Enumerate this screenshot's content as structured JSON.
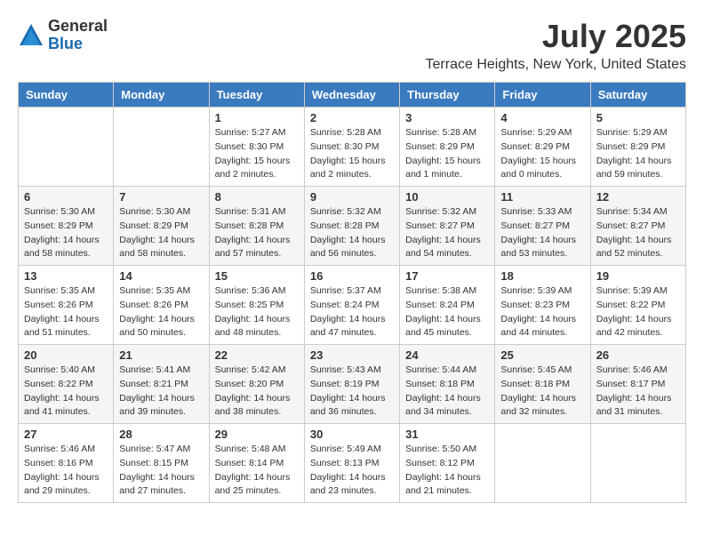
{
  "header": {
    "logo_general": "General",
    "logo_blue": "Blue",
    "month_year": "July 2025",
    "location": "Terrace Heights, New York, United States"
  },
  "weekdays": [
    "Sunday",
    "Monday",
    "Tuesday",
    "Wednesday",
    "Thursday",
    "Friday",
    "Saturday"
  ],
  "weeks": [
    [
      {
        "day": "",
        "info": ""
      },
      {
        "day": "",
        "info": ""
      },
      {
        "day": "1",
        "info": "Sunrise: 5:27 AM\nSunset: 8:30 PM\nDaylight: 15 hours\nand 2 minutes."
      },
      {
        "day": "2",
        "info": "Sunrise: 5:28 AM\nSunset: 8:30 PM\nDaylight: 15 hours\nand 2 minutes."
      },
      {
        "day": "3",
        "info": "Sunrise: 5:28 AM\nSunset: 8:29 PM\nDaylight: 15 hours\nand 1 minute."
      },
      {
        "day": "4",
        "info": "Sunrise: 5:29 AM\nSunset: 8:29 PM\nDaylight: 15 hours\nand 0 minutes."
      },
      {
        "day": "5",
        "info": "Sunrise: 5:29 AM\nSunset: 8:29 PM\nDaylight: 14 hours\nand 59 minutes."
      }
    ],
    [
      {
        "day": "6",
        "info": "Sunrise: 5:30 AM\nSunset: 8:29 PM\nDaylight: 14 hours\nand 58 minutes."
      },
      {
        "day": "7",
        "info": "Sunrise: 5:30 AM\nSunset: 8:29 PM\nDaylight: 14 hours\nand 58 minutes."
      },
      {
        "day": "8",
        "info": "Sunrise: 5:31 AM\nSunset: 8:28 PM\nDaylight: 14 hours\nand 57 minutes."
      },
      {
        "day": "9",
        "info": "Sunrise: 5:32 AM\nSunset: 8:28 PM\nDaylight: 14 hours\nand 56 minutes."
      },
      {
        "day": "10",
        "info": "Sunrise: 5:32 AM\nSunset: 8:27 PM\nDaylight: 14 hours\nand 54 minutes."
      },
      {
        "day": "11",
        "info": "Sunrise: 5:33 AM\nSunset: 8:27 PM\nDaylight: 14 hours\nand 53 minutes."
      },
      {
        "day": "12",
        "info": "Sunrise: 5:34 AM\nSunset: 8:27 PM\nDaylight: 14 hours\nand 52 minutes."
      }
    ],
    [
      {
        "day": "13",
        "info": "Sunrise: 5:35 AM\nSunset: 8:26 PM\nDaylight: 14 hours\nand 51 minutes."
      },
      {
        "day": "14",
        "info": "Sunrise: 5:35 AM\nSunset: 8:26 PM\nDaylight: 14 hours\nand 50 minutes."
      },
      {
        "day": "15",
        "info": "Sunrise: 5:36 AM\nSunset: 8:25 PM\nDaylight: 14 hours\nand 48 minutes."
      },
      {
        "day": "16",
        "info": "Sunrise: 5:37 AM\nSunset: 8:24 PM\nDaylight: 14 hours\nand 47 minutes."
      },
      {
        "day": "17",
        "info": "Sunrise: 5:38 AM\nSunset: 8:24 PM\nDaylight: 14 hours\nand 45 minutes."
      },
      {
        "day": "18",
        "info": "Sunrise: 5:39 AM\nSunset: 8:23 PM\nDaylight: 14 hours\nand 44 minutes."
      },
      {
        "day": "19",
        "info": "Sunrise: 5:39 AM\nSunset: 8:22 PM\nDaylight: 14 hours\nand 42 minutes."
      }
    ],
    [
      {
        "day": "20",
        "info": "Sunrise: 5:40 AM\nSunset: 8:22 PM\nDaylight: 14 hours\nand 41 minutes."
      },
      {
        "day": "21",
        "info": "Sunrise: 5:41 AM\nSunset: 8:21 PM\nDaylight: 14 hours\nand 39 minutes."
      },
      {
        "day": "22",
        "info": "Sunrise: 5:42 AM\nSunset: 8:20 PM\nDaylight: 14 hours\nand 38 minutes."
      },
      {
        "day": "23",
        "info": "Sunrise: 5:43 AM\nSunset: 8:19 PM\nDaylight: 14 hours\nand 36 minutes."
      },
      {
        "day": "24",
        "info": "Sunrise: 5:44 AM\nSunset: 8:18 PM\nDaylight: 14 hours\nand 34 minutes."
      },
      {
        "day": "25",
        "info": "Sunrise: 5:45 AM\nSunset: 8:18 PM\nDaylight: 14 hours\nand 32 minutes."
      },
      {
        "day": "26",
        "info": "Sunrise: 5:46 AM\nSunset: 8:17 PM\nDaylight: 14 hours\nand 31 minutes."
      }
    ],
    [
      {
        "day": "27",
        "info": "Sunrise: 5:46 AM\nSunset: 8:16 PM\nDaylight: 14 hours\nand 29 minutes."
      },
      {
        "day": "28",
        "info": "Sunrise: 5:47 AM\nSunset: 8:15 PM\nDaylight: 14 hours\nand 27 minutes."
      },
      {
        "day": "29",
        "info": "Sunrise: 5:48 AM\nSunset: 8:14 PM\nDaylight: 14 hours\nand 25 minutes."
      },
      {
        "day": "30",
        "info": "Sunrise: 5:49 AM\nSunset: 8:13 PM\nDaylight: 14 hours\nand 23 minutes."
      },
      {
        "day": "31",
        "info": "Sunrise: 5:50 AM\nSunset: 8:12 PM\nDaylight: 14 hours\nand 21 minutes."
      },
      {
        "day": "",
        "info": ""
      },
      {
        "day": "",
        "info": ""
      }
    ]
  ]
}
